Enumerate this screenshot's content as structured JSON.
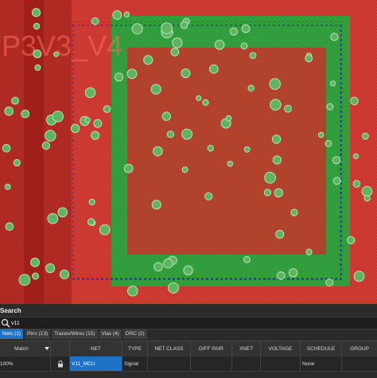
{
  "board": {
    "silkscreen_text": "P3V3_V4",
    "colors": {
      "top_copper": "#c8322a",
      "bottom_copper": "#2e9a3a",
      "highlight_vias": "#3a3ab8",
      "pad_ring": "#9cd49c"
    }
  },
  "search": {
    "title": "Search",
    "query": "v11",
    "icon": "search-icon"
  },
  "tabs": [
    {
      "label": "Nets (1)",
      "active": true
    },
    {
      "label": "Pins (13)",
      "active": false
    },
    {
      "label": "Traces/Wires (15)",
      "active": false
    },
    {
      "label": "Vias (4)",
      "active": false
    },
    {
      "label": "DRC (2)",
      "active": false
    }
  ],
  "columns": {
    "match": "Match",
    "net": "NET",
    "type": "TYPE",
    "net_class": "NET CLASS",
    "diff_pair": "DIFF PAIR",
    "xnet": "XNET",
    "voltage": "VOLTAGE",
    "schedule": "SCHEDULE",
    "group": "GROUP"
  },
  "rows": [
    {
      "match": "100%",
      "lock_icon": "lock-icon",
      "net": "V11_MCU",
      "type": "Signal",
      "net_class": "",
      "diff_pair": "",
      "xnet": "",
      "voltage": "",
      "schedule": "None",
      "group": ""
    }
  ]
}
